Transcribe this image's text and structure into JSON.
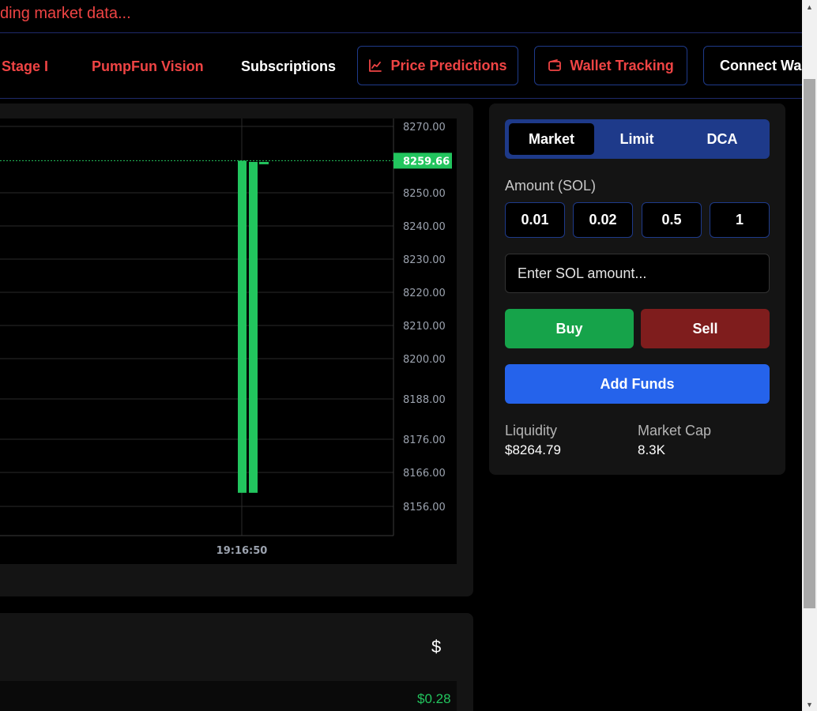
{
  "banner": {
    "text": "ding market data..."
  },
  "nav": {
    "links": [
      {
        "label": "Stage I"
      },
      {
        "label": "PumpFun Vision"
      },
      {
        "label": "Subscriptions"
      }
    ],
    "price_predictions": "Price Predictions",
    "wallet_tracking": "Wallet Tracking",
    "connect_wallet": "Connect Wall"
  },
  "chart_data": {
    "type": "bar",
    "y_ticks": [
      "8270.00",
      "8250.00",
      "8240.00",
      "8230.00",
      "8220.00",
      "8210.00",
      "8200.00",
      "8188.00",
      "8176.00",
      "8166.00",
      "8156.00"
    ],
    "x_ticks": [
      "19:16:50"
    ],
    "current_price": "8259.66",
    "candles": [
      {
        "open": 8160,
        "close": 8259.66
      },
      {
        "open": 8160,
        "close": 8259.3
      },
      {
        "open": 8258.9,
        "close": 8259.3
      }
    ],
    "colors": {
      "up": "#22c55e",
      "price_line": "#22c55e",
      "grid": "#2a2a2a"
    }
  },
  "bottom": {
    "currency_symbol": "$",
    "value": "$0.28"
  },
  "trade": {
    "tabs": [
      {
        "label": "Market",
        "active": true
      },
      {
        "label": "Limit",
        "active": false
      },
      {
        "label": "DCA",
        "active": false
      }
    ],
    "amount_label": "Amount (SOL)",
    "presets": [
      "0.01",
      "0.02",
      "0.5",
      "1"
    ],
    "amount_placeholder": "Enter SOL amount...",
    "buy_label": "Buy",
    "sell_label": "Sell",
    "add_funds_label": "Add Funds",
    "liquidity_label": "Liquidity",
    "liquidity_value": "$8264.79",
    "market_cap_label": "Market Cap",
    "market_cap_value": "8.3K"
  }
}
